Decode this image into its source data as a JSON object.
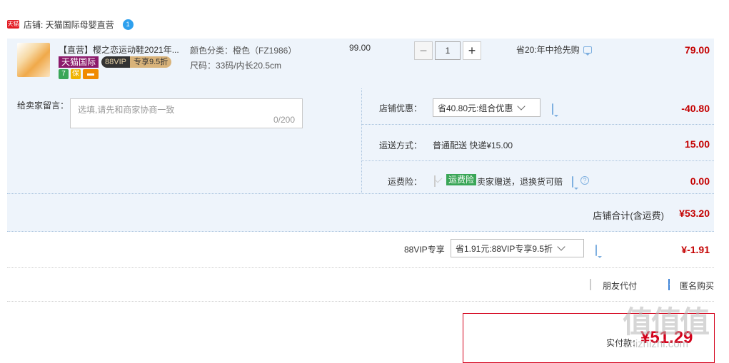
{
  "shop": {
    "badge": "天猫",
    "label": "店铺: 天猫国际母婴直营",
    "ww_glyph": "1"
  },
  "item": {
    "title": "【直营】樱之恋运动鞋2021年...",
    "tag_tmall": "天猫国际",
    "tag_vip_a": "88VIP",
    "tag_vip_b": "专享9.5折",
    "sku_color": "颜色分类：橙色（FZ1986）",
    "sku_size": "尺码：33码/内长20.5cm",
    "price": "99.00",
    "qty": "1",
    "minus": "−",
    "plus": "+",
    "promo": "省20:年中抢先购",
    "amount": "79.00"
  },
  "memo": {
    "label": "给卖家留言：",
    "placeholder": "选填,请先和商家协商一致",
    "count": "0/200"
  },
  "shop_discount": {
    "label": "店铺优惠：",
    "selected": "省40.80元:组合优惠",
    "amount": "-40.80"
  },
  "shipping": {
    "label": "运送方式：",
    "value": "普通配送 快递¥15.00",
    "amount": "15.00"
  },
  "insurance": {
    "label": "运费险：",
    "tag": "运费险",
    "text": "卖家赠送，退换货可赔",
    "amount": "0.00",
    "help": "?"
  },
  "shop_total": {
    "label": "店铺合计(含运费)",
    "amount": "¥53.20"
  },
  "vip": {
    "label": "88VIP专享",
    "selected": "省1.91元:88VIP专享9.5折",
    "amount": "¥-1.91"
  },
  "options": {
    "friend_pay": "朋友代付",
    "anonymous": "匿名购买"
  },
  "pay": {
    "label": "实付款：",
    "amount": "¥51.29"
  },
  "watermark": {
    "big": "值值值",
    "small": "zhizhizhi.com"
  },
  "colors": {
    "accent": "#c40000",
    "row_bg": "#eef4fb",
    "check": "#3b82d6",
    "tmall_red": "#e31b23"
  }
}
